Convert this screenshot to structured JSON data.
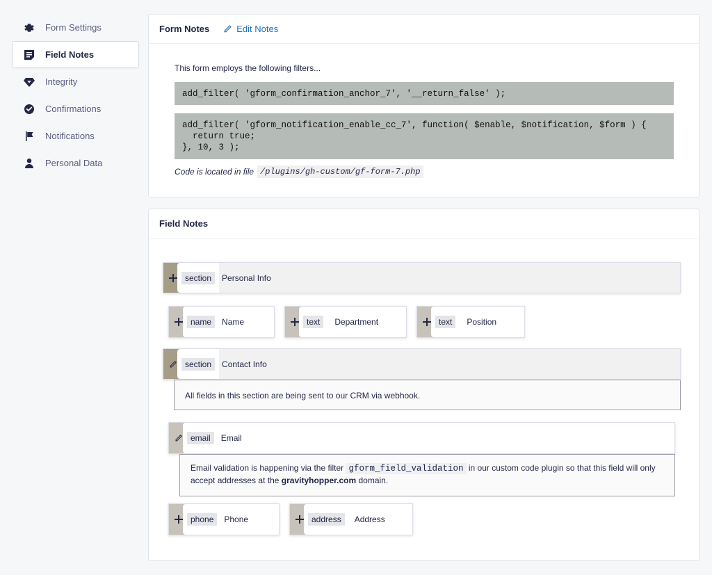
{
  "sidebar": {
    "items": [
      {
        "label": "Form Settings",
        "icon": "gear-icon"
      },
      {
        "label": "Field Notes",
        "icon": "notes-icon",
        "active": true
      },
      {
        "label": "Integrity",
        "icon": "diamond-icon"
      },
      {
        "label": "Confirmations",
        "icon": "check-circle-icon"
      },
      {
        "label": "Notifications",
        "icon": "flag-icon"
      },
      {
        "label": "Personal Data",
        "icon": "person-icon"
      }
    ]
  },
  "form_notes": {
    "title": "Form Notes",
    "edit_label": "Edit Notes",
    "intro": "This form employs the following filters...",
    "code1": "add_filter( 'gform_confirmation_anchor_7', '__return_false' );",
    "code2": "add_filter( 'gform_notification_enable_cc_7', function( $enable, $notification, $form ) {\n  return true;\n}, 10, 3 );",
    "file_prefix": "Code is located in file",
    "file_path": "/plugins/gh-custom/gf-form-7.php"
  },
  "field_notes": {
    "title": "Field Notes",
    "fields": {
      "personal_section": {
        "type": "section",
        "label": "Personal Info"
      },
      "name": {
        "type": "name",
        "label": "Name"
      },
      "department": {
        "type": "text",
        "label": "Department"
      },
      "position": {
        "type": "text",
        "label": "Position"
      },
      "contact_section": {
        "type": "section",
        "label": "Contact Info",
        "note": "All fields in this section are being sent to our CRM via webhook."
      },
      "email": {
        "type": "email",
        "label": "Email",
        "note_part1": "Email validation is happening via the filter",
        "note_code": "gform_field_validation",
        "note_part2": "in our custom code plugin so that this field will only accept addresses at the",
        "note_domain": "gravityhopper.com",
        "note_part3": "domain."
      },
      "phone": {
        "type": "phone",
        "label": "Phone"
      },
      "address": {
        "type": "address",
        "label": "Address"
      }
    }
  },
  "colors": {
    "accent": "#2271b1",
    "code_bg": "#b5bbb6",
    "section_handle": "#a69d88",
    "field_handle": "#c7c2ba"
  }
}
